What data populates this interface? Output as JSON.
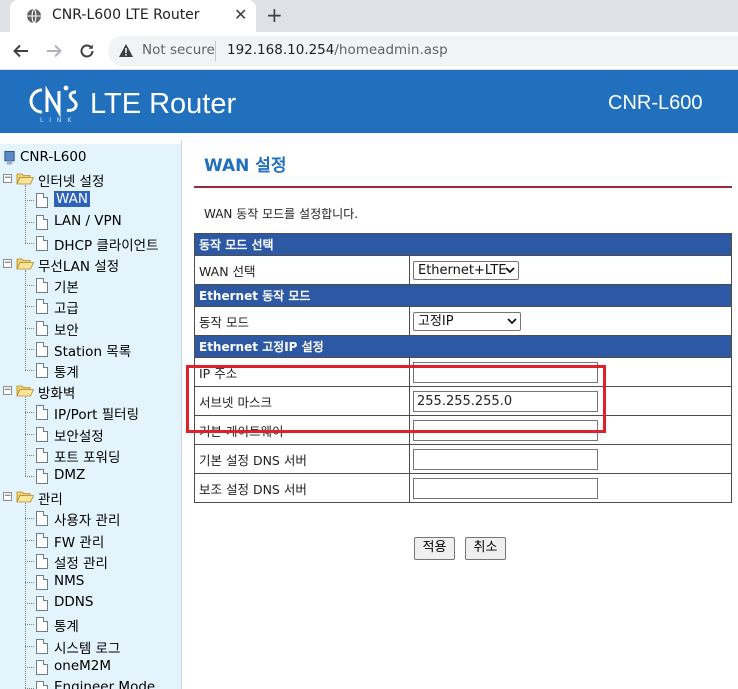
{
  "browser": {
    "tab_title": "CNR-L600 LTE Router",
    "tab_close": "✕",
    "new_tab": "+",
    "not_secure": "Not secure",
    "url_host": "192.168.10.254",
    "url_path": "/homeadmin.asp"
  },
  "header": {
    "logo_text": "LTE Router",
    "logo_sub": "L I N K",
    "model": "CNR-L600",
    "background": "#2170be"
  },
  "sidebar": {
    "root": "CNR-L600",
    "groups": [
      {
        "label": "인터넷 설정",
        "items": [
          "WAN",
          "LAN / VPN",
          "DHCP 클라이언트"
        ]
      },
      {
        "label": "무선LAN 설정",
        "items": [
          "기본",
          "고급",
          "보안",
          "Station 목록",
          "통계"
        ]
      },
      {
        "label": "방화벽",
        "items": [
          "IP/Port 필터링",
          "보안설정",
          "포트 포워딩",
          "DMZ"
        ]
      },
      {
        "label": "관리",
        "items": [
          "사용자 관리",
          "FW 관리",
          "설정 관리",
          "NMS",
          "DDNS",
          "통계",
          "시스템 로그",
          "oneM2M",
          "Engineer Mode"
        ]
      }
    ],
    "selected": "WAN"
  },
  "content": {
    "title": "WAN 설정",
    "description": "WAN 동작 모드를 설정합니다.",
    "sections": [
      {
        "header": "동작 모드 선택",
        "rows": [
          {
            "label": "WAN 선택",
            "type": "select",
            "value": "Ethernet+LTE"
          }
        ]
      },
      {
        "header": "Ethernet 동작 모드",
        "rows": [
          {
            "label": "동작 모드",
            "type": "select",
            "value": "고정IP"
          }
        ]
      },
      {
        "header": "Ethernet 고정IP 설정",
        "rows": [
          {
            "label": "IP 주소",
            "type": "text",
            "value": ""
          },
          {
            "label": "서브넷 마스크",
            "type": "text",
            "value": "255.255.255.0"
          },
          {
            "label": "기본 게이트웨이",
            "type": "text",
            "value": ""
          },
          {
            "label": "기본 설정 DNS 서버",
            "type": "text",
            "value": ""
          },
          {
            "label": "보조 설정 DNS 서버",
            "type": "text",
            "value": ""
          }
        ]
      }
    ],
    "apply_label": "적용",
    "cancel_label": "취소",
    "accent_color": "#2d58a3",
    "highlight_color": "#e0202a"
  }
}
